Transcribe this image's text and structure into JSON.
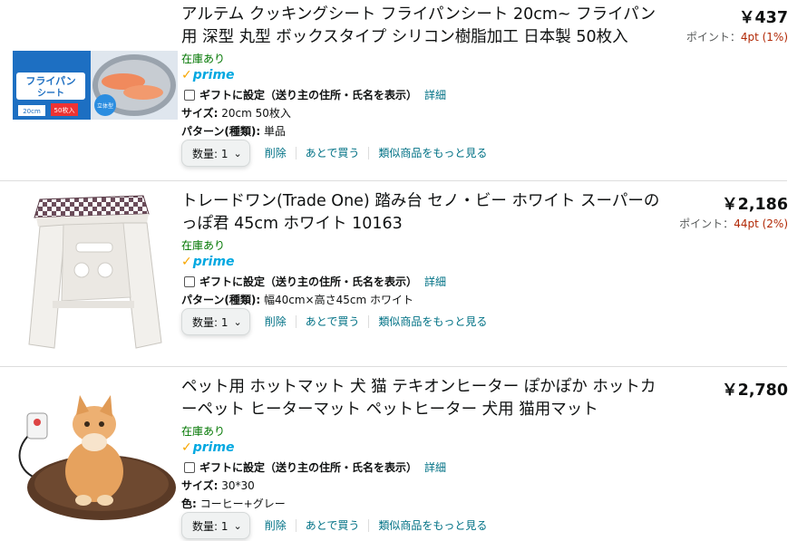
{
  "items": [
    {
      "title": "アルテム クッキングシート フライパンシート 20cm~ フライパン用 深型 丸型 ボックスタイプ シリコン樹脂加工 日本製 50枚入",
      "price": "￥437",
      "points_label": "ポイント：",
      "points_value": "4pt (1%)",
      "stock": "在庫あり",
      "prime": "prime",
      "gift_label": "ギフトに設定（送り主の住所・氏名を表示）",
      "gift_link": "詳細",
      "attrs": [
        {
          "key": "サイズ:",
          "value": "20cm 50枚入"
        },
        {
          "key": "パターン(種類):",
          "value": "単品"
        }
      ],
      "qty_label": "数量: 1",
      "delete": "削除",
      "save_later": "あとで買う",
      "similar": "類似商品をもっと見る",
      "thumb_text_1": "フライパン",
      "thumb_text_2": "シート",
      "thumb_size": "20cm",
      "thumb_count": "50枚入"
    },
    {
      "title": "トレードワン(Trade One) 踏み台 セノ・ビー ホワイト スーパーのっぽ君 45cm ホワイト 10163",
      "price": "￥2,186",
      "points_label": "ポイント：",
      "points_value": "44pt (2%)",
      "stock": "在庫あり",
      "prime": "prime",
      "gift_label": "ギフトに設定（送り主の住所・氏名を表示）",
      "gift_link": "詳細",
      "attrs": [
        {
          "key": "パターン(種類):",
          "value": "幅40cm×高さ45cm ホワイト"
        }
      ],
      "qty_label": "数量: 1",
      "delete": "削除",
      "save_later": "あとで買う",
      "similar": "類似商品をもっと見る"
    },
    {
      "title": "ペット用 ホットマット 犬 猫 テキオンヒーター ぽかぽか ホットカーペット ヒーターマット ペットヒーター 犬用 猫用マット",
      "price": "￥2,780",
      "stock": "在庫あり",
      "prime": "prime",
      "gift_label": "ギフトに設定（送り主の住所・氏名を表示）",
      "gift_link": "詳細",
      "attrs": [
        {
          "key": "サイズ:",
          "value": "30*30"
        },
        {
          "key": "色:",
          "value": "コーヒー+グレー"
        }
      ],
      "qty_label": "数量: 1",
      "delete": "削除",
      "save_later": "あとで買う",
      "similar": "類似商品をもっと見る"
    }
  ],
  "colors": {
    "link": "#007185",
    "stock": "#007600",
    "points": "#b12704",
    "prime_blue": "#00a8e1",
    "prime_check": "#f7a600"
  },
  "icons": {
    "prime_check": "check-icon",
    "qty_chevron": "chevron-down-icon"
  }
}
